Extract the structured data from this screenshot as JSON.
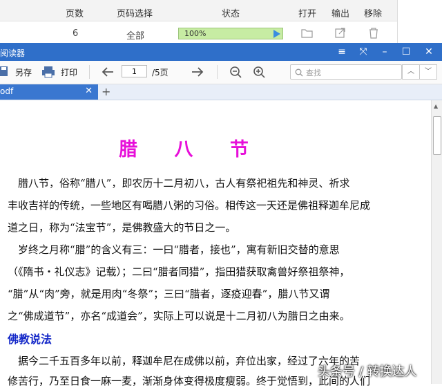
{
  "converter": {
    "columns": [
      "页数",
      "页码选择",
      "状态",
      "打开",
      "输出",
      "移除"
    ],
    "row": {
      "pages": "6",
      "range": "全部",
      "progress_text": "100%",
      "progress_fraction": 1.0
    }
  },
  "reader": {
    "title": "阅读器",
    "toolbar": {
      "save_as": "另存",
      "print": "打印",
      "page_current": "1",
      "page_total": "/5页",
      "search_placeholder": "查找"
    },
    "tab": {
      "label": "odf"
    },
    "document": {
      "title": "腊 八 节",
      "lines": [
        "　腊八节，俗称“腊八”，即农历十二月初八，古人有祭祀祖先和神灵、祈求",
        "丰收吉祥的传统，一些地区有喝腊八粥的习俗。相传这一天还是佛祖释迦牟尼成",
        "道之日，称为“法宝节”，是佛教盛大的节日之一。",
        "　岁终之月称“腊”的含义有三：一曰“腊者，接也”，寓有新旧交替的意思",
        "（《隋书・礼仪志》记载）；二曰“腊者同猎”，指田猎获取禽兽好祭祖祭神，",
        "“腊”从“肉”旁，就是用肉“冬祭”；三曰“腊者，逐疫迎春”，腊八节又谓",
        "之“佛成道节”，亦名“成道会”，实际上可以说是十二月初八为腊日之由来。"
      ],
      "section_heading": "佛教说法",
      "section_lines": [
        "　据今二千五百多年以前，释迦牟尼在成佛以前，弃位出家，经过了六年的苦",
        "修苦行，乃至日食一麻一麦，渐渐身体变得极度瘦弱。终于觉悟到，此间的人们"
      ]
    },
    "watermark": "头条号 / 转换达人"
  }
}
